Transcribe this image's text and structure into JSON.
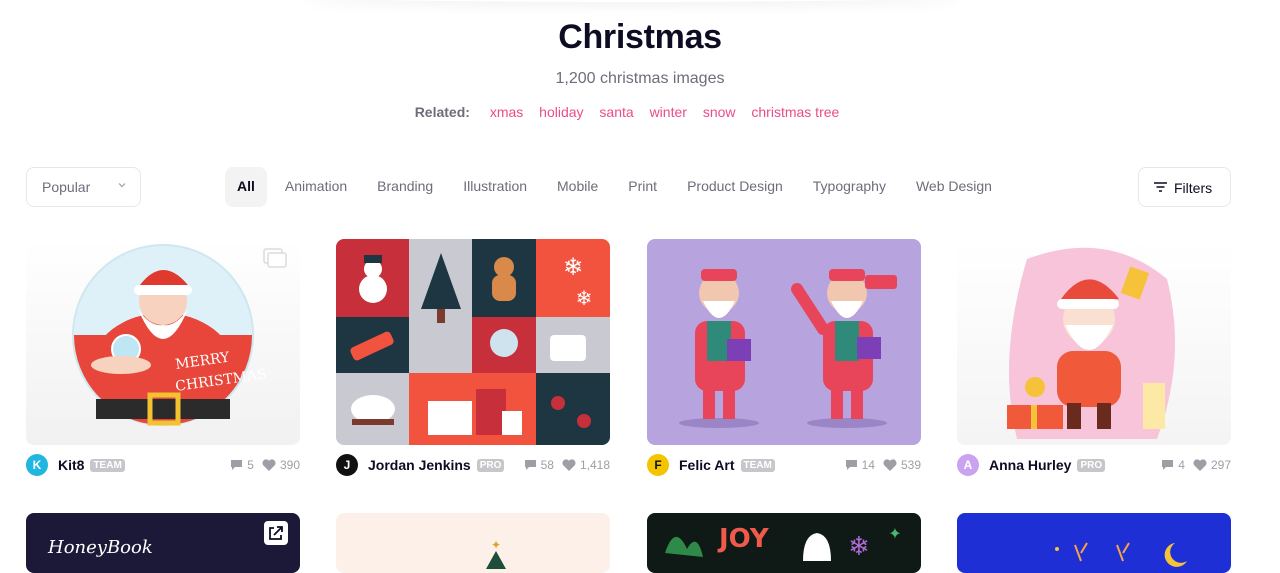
{
  "header": {
    "title": "Christmas",
    "subtitle": "1,200 christmas images",
    "related_label": "Related:",
    "related_tags": [
      "xmas",
      "holiday",
      "santa",
      "winter",
      "snow",
      "christmas tree"
    ]
  },
  "sort": {
    "value": "Popular"
  },
  "categories": [
    "All",
    "Animation",
    "Branding",
    "Illustration",
    "Mobile",
    "Print",
    "Product Design",
    "Typography",
    "Web Design"
  ],
  "filters_label": "Filters",
  "shots": [
    {
      "author": "Kit8",
      "badge": "TEAM",
      "comments": "5",
      "likes": "390",
      "avatar_letter": "K",
      "avatar_color": "#1fb6e0"
    },
    {
      "author": "Jordan Jenkins",
      "badge": "PRO",
      "comments": "58",
      "likes": "1,418",
      "avatar_letter": "J",
      "avatar_color": "#111111"
    },
    {
      "author": "Felic Art",
      "badge": "TEAM",
      "comments": "14",
      "likes": "539",
      "avatar_letter": "F",
      "avatar_color": "#f5c400"
    },
    {
      "author": "Anna Hurley",
      "badge": "PRO",
      "comments": "4",
      "likes": "297",
      "avatar_letter": "A",
      "avatar_color": "#c9a2f0"
    }
  ],
  "second_row": {
    "shot1_logo": "HoneyBook",
    "shot3_text": "JOY"
  },
  "colors": {
    "accent": "#ea4c89",
    "text": "#0d0c22",
    "muted": "#6e6d7a"
  }
}
